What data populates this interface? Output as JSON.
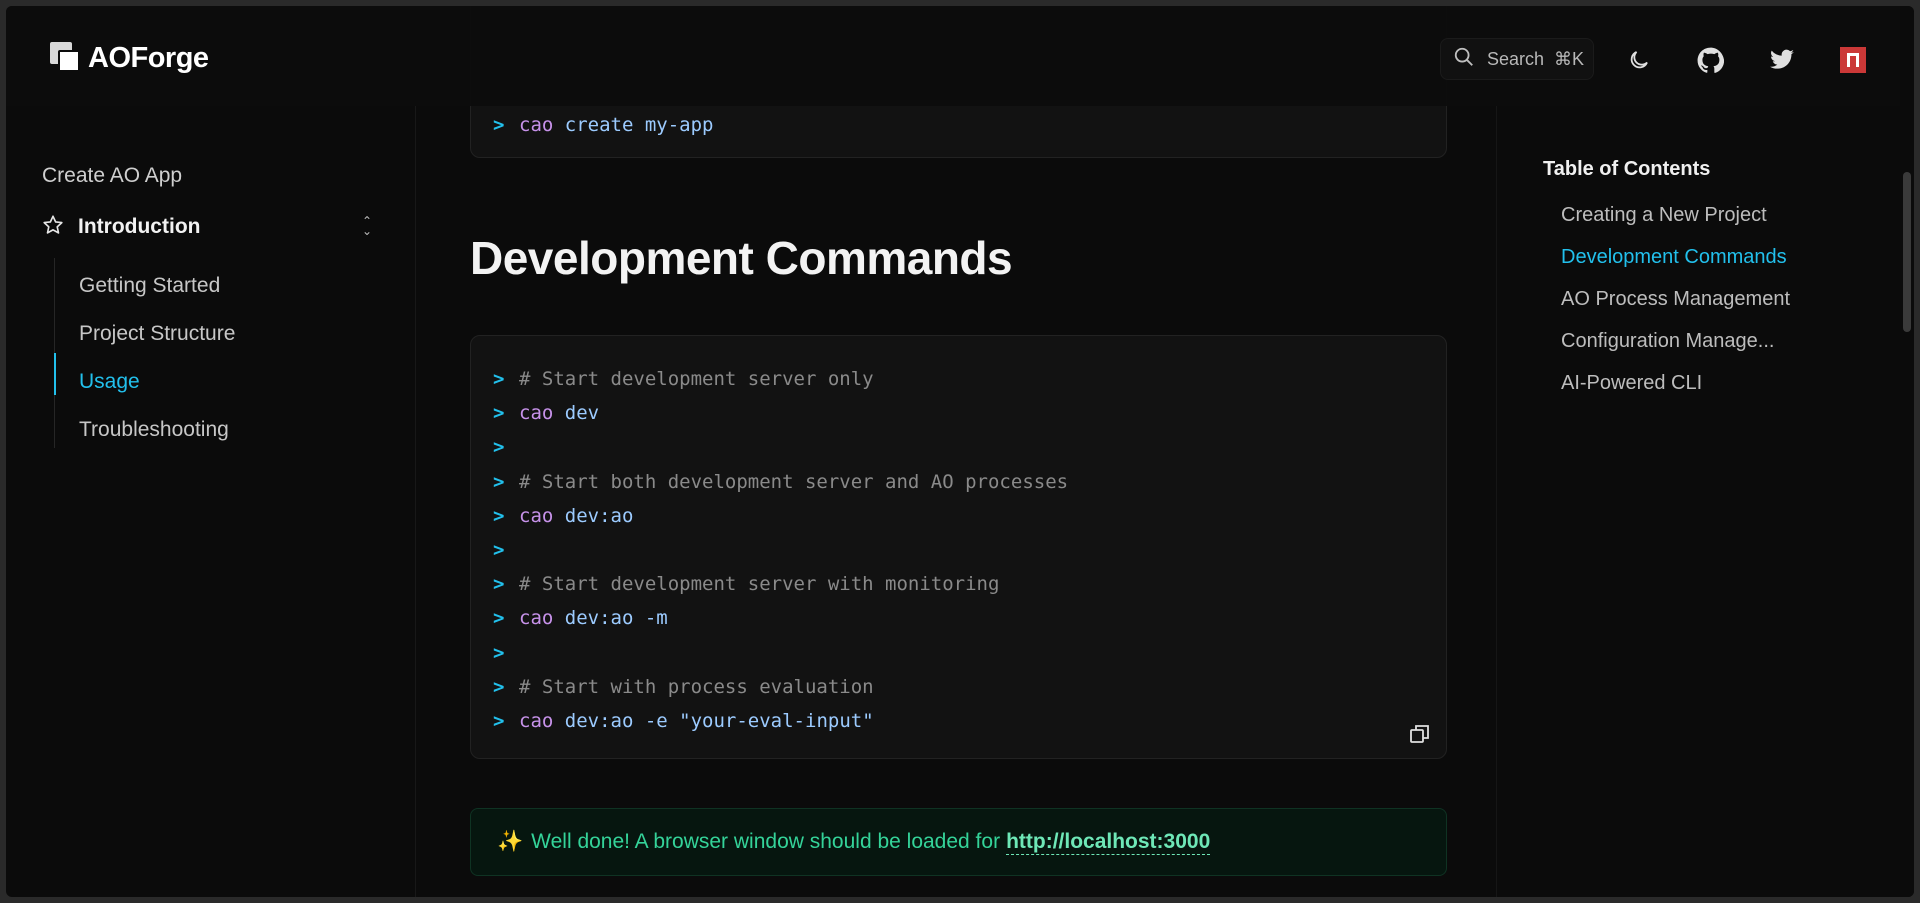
{
  "header": {
    "logo_text": "AOForge",
    "search_label": "Search",
    "search_shortcut": "⌘K",
    "icons": [
      "moon-icon",
      "github-icon",
      "twitter-icon",
      "npm-icon"
    ]
  },
  "sidebar": {
    "top_link": "Create AO App",
    "section_label": "Introduction",
    "items": [
      {
        "label": "Getting Started",
        "active": false
      },
      {
        "label": "Project Structure",
        "active": false
      },
      {
        "label": "Usage",
        "active": true
      },
      {
        "label": "Troubleshooting",
        "active": false
      }
    ]
  },
  "main": {
    "top_code": {
      "prompt": ">",
      "cmd": "cao",
      "rest": " create my-app"
    },
    "heading": "Development Commands",
    "code_lines": [
      {
        "type": "comment",
        "text": "# Start development server only"
      },
      {
        "type": "cmd",
        "cmd": "cao",
        "rest": " dev"
      },
      {
        "type": "empty",
        "text": ""
      },
      {
        "type": "comment",
        "text": "# Start both development server and AO processes"
      },
      {
        "type": "cmd",
        "cmd": "cao",
        "rest": " dev:ao"
      },
      {
        "type": "empty",
        "text": ""
      },
      {
        "type": "comment",
        "text": "# Start development server with monitoring"
      },
      {
        "type": "cmd",
        "cmd": "cao",
        "rest": " dev:ao -m"
      },
      {
        "type": "empty",
        "text": ""
      },
      {
        "type": "comment",
        "text": "# Start with process evaluation"
      },
      {
        "type": "cmd",
        "cmd": "cao",
        "rest": " dev:ao -e ",
        "str": "\"your-eval-input\""
      }
    ],
    "callout": {
      "emoji": "✨",
      "text": "Well done! A browser window should be loaded for",
      "link": "http://localhost:3000"
    }
  },
  "toc": {
    "title": "Table of Contents",
    "items": [
      {
        "label": "Creating a New Project",
        "active": false
      },
      {
        "label": "Development Commands",
        "active": true
      },
      {
        "label": "AO Process Management",
        "active": false
      },
      {
        "label": "Configuration Manage...",
        "active": false
      },
      {
        "label": "AI-Powered CLI",
        "active": false
      }
    ]
  },
  "colors": {
    "accent": "#22c0ec",
    "background": "#0b0b0b",
    "callout_text": "#34d399"
  }
}
